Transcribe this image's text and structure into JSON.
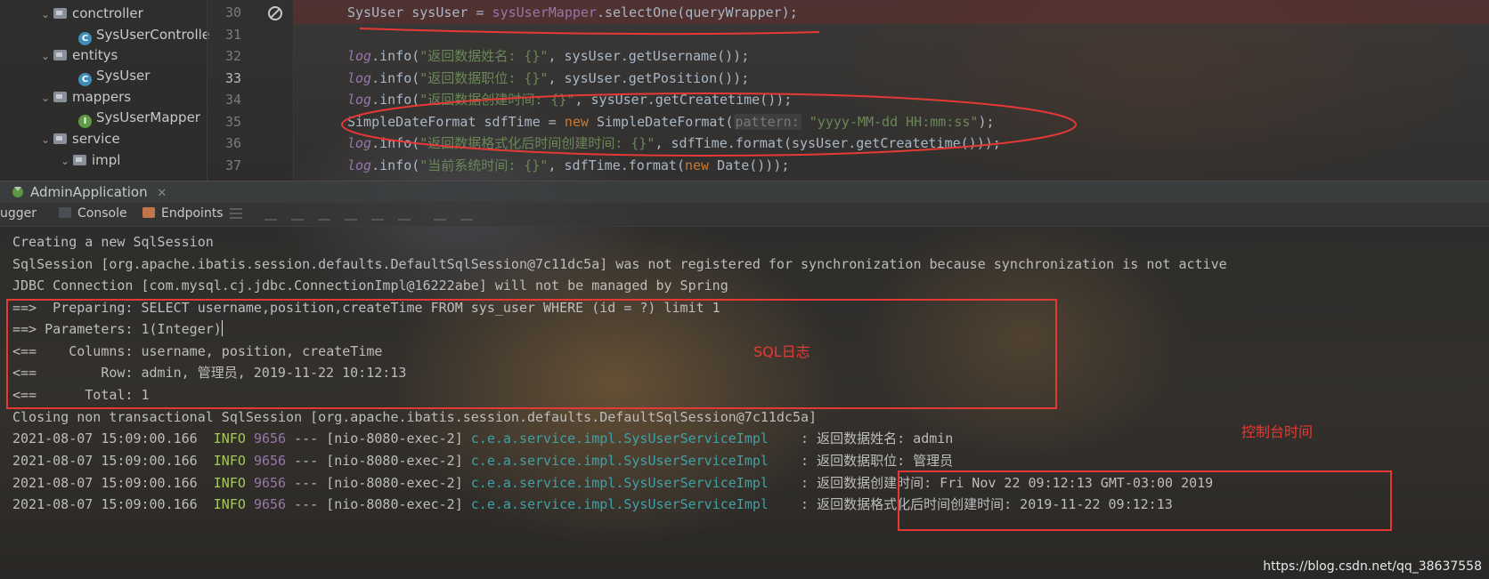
{
  "project_tree": {
    "items": [
      {
        "label": "conctroller",
        "type": "folder",
        "expanded": true
      },
      {
        "label": "SysUserControlle",
        "type": "class"
      },
      {
        "label": "entitys",
        "type": "folder",
        "expanded": true
      },
      {
        "label": "SysUser",
        "type": "class"
      },
      {
        "label": "mappers",
        "type": "folder",
        "expanded": true
      },
      {
        "label": "SysUserMapper",
        "type": "interface"
      },
      {
        "label": "service",
        "type": "folder",
        "expanded": true
      },
      {
        "label": "impl",
        "type": "folder",
        "expanded": true
      }
    ]
  },
  "editor": {
    "line_numbers": [
      "30",
      "31",
      "32",
      "33",
      "34",
      "35",
      "36",
      "37"
    ],
    "current_line": "33",
    "lines": {
      "l30": {
        "type": "SysUser",
        "var": " sysUser = ",
        "field": "sysUserMapper",
        "call": ".selectOne(queryWrapper);"
      },
      "l32": {
        "log": "log",
        "m": ".info(",
        "s": "\"返回数据姓名: {}\"",
        "rest": ", sysUser.getUsername());"
      },
      "l33": {
        "log": "log",
        "m": ".info(",
        "s": "\"返回数据职位: {}\"",
        "rest": ", sysUser.getPosition());"
      },
      "l34": {
        "log": "log",
        "m": ".info(",
        "s": "\"返回数据创建时间: {}\"",
        "rest": ", sysUser.getCreatetime());"
      },
      "l35": {
        "a": "SimpleDateFormat sdfTime = ",
        "kw": "new",
        "b": " SimpleDateFormat(",
        "hint": "pattern:",
        "s": " \"yyyy-MM-dd HH:mm:ss\"",
        "end": ");"
      },
      "l36": {
        "log": "log",
        "m": ".info(",
        "s": "\"返回数据格式化后时间创建时间: {}\"",
        "rest": ", sdfTime.format(sysUser.getCreatetime()));"
      },
      "l37": {
        "log": "log",
        "m": ".info(",
        "s": "\"当前系统时间: {}\"",
        "a": ", sdfTime.format(",
        "kw": "new",
        "b": " Date()));"
      }
    }
  },
  "run_panel": {
    "tab_label": "AdminApplication",
    "toolbar": {
      "debugger": "ugger",
      "console": "Console",
      "endpoints": "Endpoints"
    }
  },
  "console": {
    "plain_lines": [
      "Creating a new SqlSession",
      "SqlSession [org.apache.ibatis.session.defaults.DefaultSqlSession@7c11dc5a] was not registered for synchronization because synchronization is not active",
      "JDBC Connection [com.mysql.cj.jdbc.ConnectionImpl@16222abe] will not be managed by Spring",
      "==>  Preparing: SELECT username,position,createTime FROM sys_user WHERE (id = ?) limit 1",
      "==> Parameters: 1(Integer)",
      "<==    Columns: username, position, createTime",
      "<==        Row: admin, 管理员, 2019-11-22 10:12:13",
      "<==      Total: 1",
      "Closing non transactional SqlSession [org.apache.ibatis.session.defaults.DefaultSqlSession@7c11dc5a]"
    ],
    "log_lines": [
      {
        "ts": "2021-08-07 15:09:00.166",
        "level": "INFO",
        "pid": "9656",
        "thread": " --- [nio-8080-exec-2] ",
        "logger": "c.e.a.service.impl.SysUserServiceImpl",
        "sep": "    : ",
        "msg": "返回数据姓名: admin"
      },
      {
        "ts": "2021-08-07 15:09:00.166",
        "level": "INFO",
        "pid": "9656",
        "thread": " --- [nio-8080-exec-2] ",
        "logger": "c.e.a.service.impl.SysUserServiceImpl",
        "sep": "    : ",
        "msg": "返回数据职位: 管理员"
      },
      {
        "ts": "2021-08-07 15:09:00.166",
        "level": "INFO",
        "pid": "9656",
        "thread": " --- [nio-8080-exec-2] ",
        "logger": "c.e.a.service.impl.SysUserServiceImpl",
        "sep": "    : ",
        "msg": "返回数据创建时间: Fri Nov 22 09:12:13 GMT-03:00 2019"
      },
      {
        "ts": "2021-08-07 15:09:00.166",
        "level": "INFO",
        "pid": "9656",
        "thread": " --- [nio-8080-exec-2] ",
        "logger": "c.e.a.service.impl.SysUserServiceImpl",
        "sep": "    : ",
        "msg": "返回数据格式化后时间创建时间: 2019-11-22 09:12:13"
      }
    ]
  },
  "annotations": {
    "sql_log": "SQL日志",
    "console_time": "控制台时间",
    "watermark": "https://blog.csdn.net/qq_38637558"
  },
  "colors": {
    "annotation_red": "#e53935",
    "log_info": "#a6c85a",
    "logger_teal": "#3fa1a8"
  }
}
